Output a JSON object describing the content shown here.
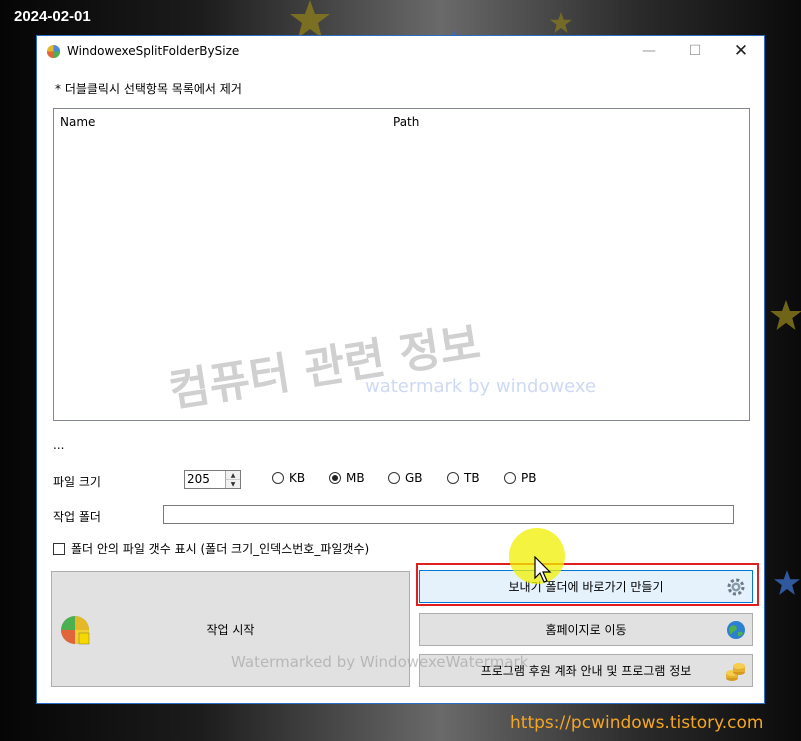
{
  "overlay": {
    "date": "2024-02-01",
    "blog_url": "https://pcwindows.tistory.com",
    "watermark_korean": "컴퓨터 관련 정보",
    "watermark_english": "watermark by windowexe",
    "watermark_bottom": "Watermarked by WindowexeWatermark"
  },
  "window": {
    "title": "WindowexeSplitFolderBySize",
    "min_icon": "—",
    "max_icon": "☐",
    "close_icon": "✕"
  },
  "hint": "* 더블클릭시 선택항목 목록에서 제거",
  "list": {
    "columns": [
      "Name",
      "Path"
    ],
    "rows": []
  },
  "status": "...",
  "size": {
    "label": "파일 크기",
    "value": "205",
    "units": [
      "KB",
      "MB",
      "GB",
      "TB",
      "PB"
    ],
    "selected_unit": "MB"
  },
  "folder": {
    "label": "작업 폴더",
    "value": ""
  },
  "show_count": {
    "label": "폴더 안의 파일 갯수 표시 (폴더 크기_인덱스번호_파일갯수)",
    "checked": false
  },
  "buttons": {
    "start": "작업 시작",
    "shortcut": "보내기 폴더에 바로가기 만들기",
    "homepage": "홈페이지로 이동",
    "info": "프로그램 후원 계좌 안내 및 프로그램 정보"
  },
  "colors": {
    "accent": "#0078d7",
    "highlight_frame": "#e02020",
    "cursor_highlight": "#f0f000",
    "url": "#f5a623"
  }
}
